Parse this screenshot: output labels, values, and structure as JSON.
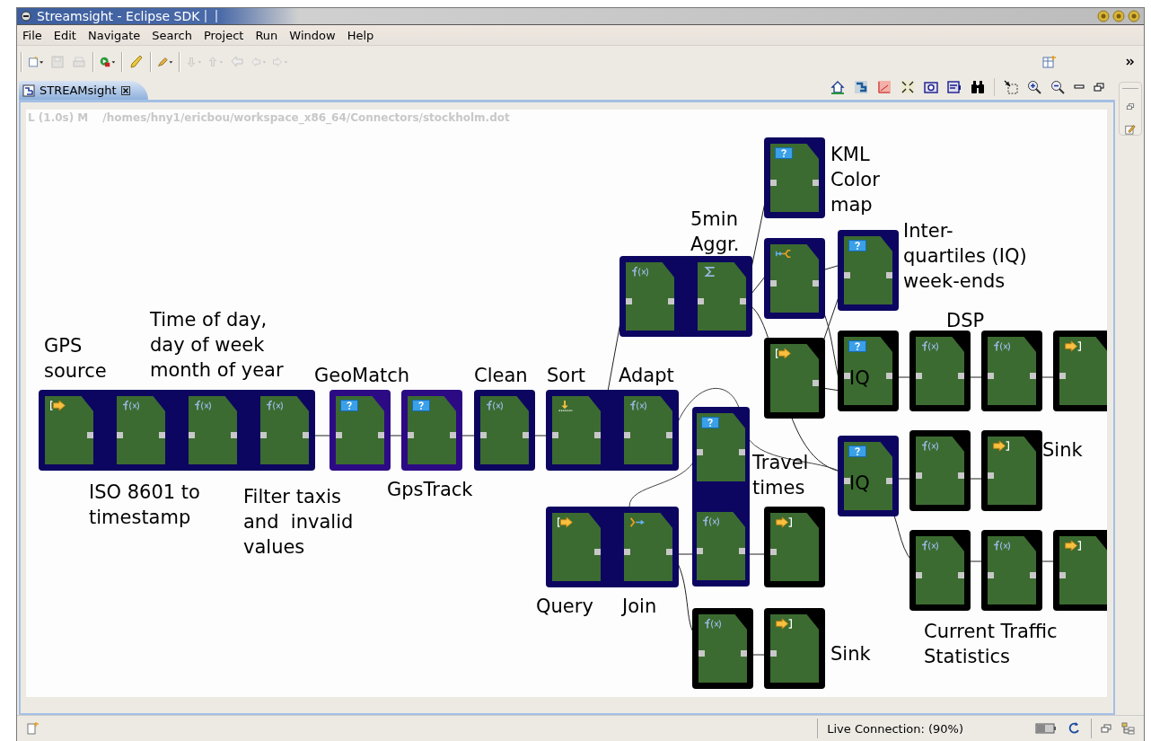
{
  "window": {
    "title": "Streamsight - Eclipse SDK"
  },
  "menu": [
    "File",
    "Edit",
    "Navigate",
    "Search",
    "Project",
    "Run",
    "Window",
    "Help"
  ],
  "tab": {
    "label": "STREAMsight",
    "selected": true
  },
  "editor": {
    "mode": "L (1.0s) M",
    "path": "/homes/hny1/ericbou/workspace_x86_64/Connectors/stockholm.dot"
  },
  "diagram": {
    "groups": [
      {
        "color": "#0c0660",
        "operators": [
          {
            "kind": "source"
          },
          {
            "kind": "function"
          },
          {
            "kind": "function"
          },
          {
            "kind": "function"
          }
        ]
      },
      {
        "color": "#2c0a84",
        "operators": [
          {
            "kind": "query"
          }
        ]
      },
      {
        "color": "#2c0a84",
        "operators": [
          {
            "kind": "query"
          }
        ]
      },
      {
        "color": "#0c0660",
        "operators": [
          {
            "kind": "function"
          }
        ]
      },
      {
        "color": "#0c0660",
        "operators": [
          {
            "kind": "sort"
          },
          {
            "kind": "function"
          }
        ]
      },
      {
        "color": "#0c0660",
        "operators": [
          {
            "kind": "function"
          },
          {
            "kind": "sum"
          }
        ]
      },
      {
        "color": "#0c0660",
        "operators": [
          {
            "kind": "query"
          }
        ]
      },
      {
        "color": "#0c0660",
        "operators": [
          {
            "kind": "split"
          }
        ]
      },
      {
        "color": "#000000",
        "operators": [
          {
            "kind": "source"
          }
        ]
      },
      {
        "color": "#0c0660",
        "operators": [
          {
            "kind": "query"
          }
        ]
      },
      {
        "color": "#000000",
        "operators": [
          {
            "kind": "query",
            "text": "IQ"
          }
        ]
      },
      {
        "color": "#000000",
        "operators": [
          {
            "kind": "function"
          }
        ]
      },
      {
        "color": "#000000",
        "operators": [
          {
            "kind": "function"
          }
        ]
      },
      {
        "color": "#000000",
        "operators": [
          {
            "kind": "sink"
          }
        ]
      },
      {
        "color": "#0c0660",
        "operators": [
          {
            "kind": "query",
            "text": "IQ"
          }
        ]
      },
      {
        "color": "#000000",
        "operators": [
          {
            "kind": "function"
          }
        ]
      },
      {
        "color": "#000000",
        "operators": [
          {
            "kind": "sink"
          }
        ]
      },
      {
        "color": "#000000",
        "operators": [
          {
            "kind": "function"
          }
        ]
      },
      {
        "color": "#000000",
        "operators": [
          {
            "kind": "function"
          }
        ]
      },
      {
        "color": "#000000",
        "operators": [
          {
            "kind": "sink"
          }
        ]
      },
      {
        "color": "#0c0660",
        "operators": [
          {
            "kind": "source"
          },
          {
            "kind": "join"
          }
        ]
      },
      {
        "color": "#0c0660",
        "operators": [
          {
            "kind": "query"
          },
          {
            "kind": "function"
          }
        ]
      },
      {
        "color": "#000000",
        "operators": [
          {
            "kind": "sink"
          }
        ]
      },
      {
        "color": "#000000",
        "operators": [
          {
            "kind": "function"
          }
        ]
      },
      {
        "color": "#000000",
        "operators": [
          {
            "kind": "sink"
          }
        ]
      }
    ],
    "labels": [
      "GPS\nsource",
      "Time of day,\nday of week\nmonth of year",
      "GeoMatch",
      "Clean",
      "Sort",
      "Adapt",
      "5min\nAggr.",
      "KML\nColor\nmap",
      "Inter-\nquartiles (IQ)\nweek-ends",
      "DSP",
      "ISO 8601 to\ntimestamp",
      "Filter taxis\nand  invalid\nvalues",
      "GpsTrack",
      "Travel\ntimes",
      "Sink",
      "Query",
      "Join",
      "Sink",
      "Current Traffic\nStatistics"
    ]
  },
  "status_bar": {
    "connection": "Live Connection: (90%)"
  }
}
